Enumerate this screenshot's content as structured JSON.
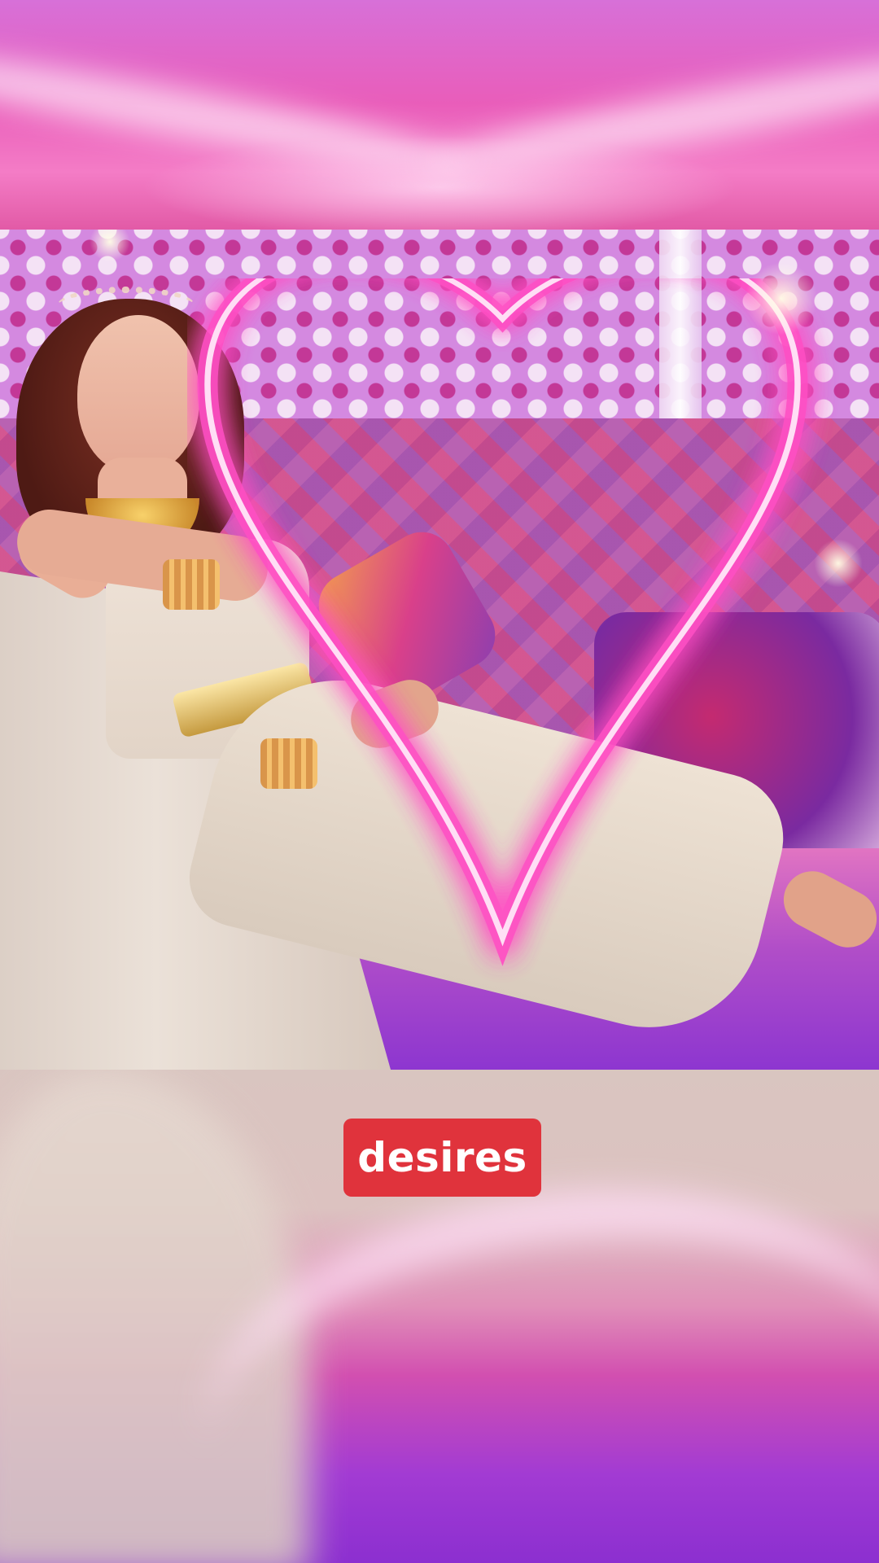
{
  "caption": {
    "text": "desires",
    "background_color": "#e0333c",
    "text_color": "#ffffff"
  },
  "video": {
    "scene": "performer-on-sofa",
    "overlay_effect": "neon-heart",
    "accent_color": "#ff4fc4"
  }
}
